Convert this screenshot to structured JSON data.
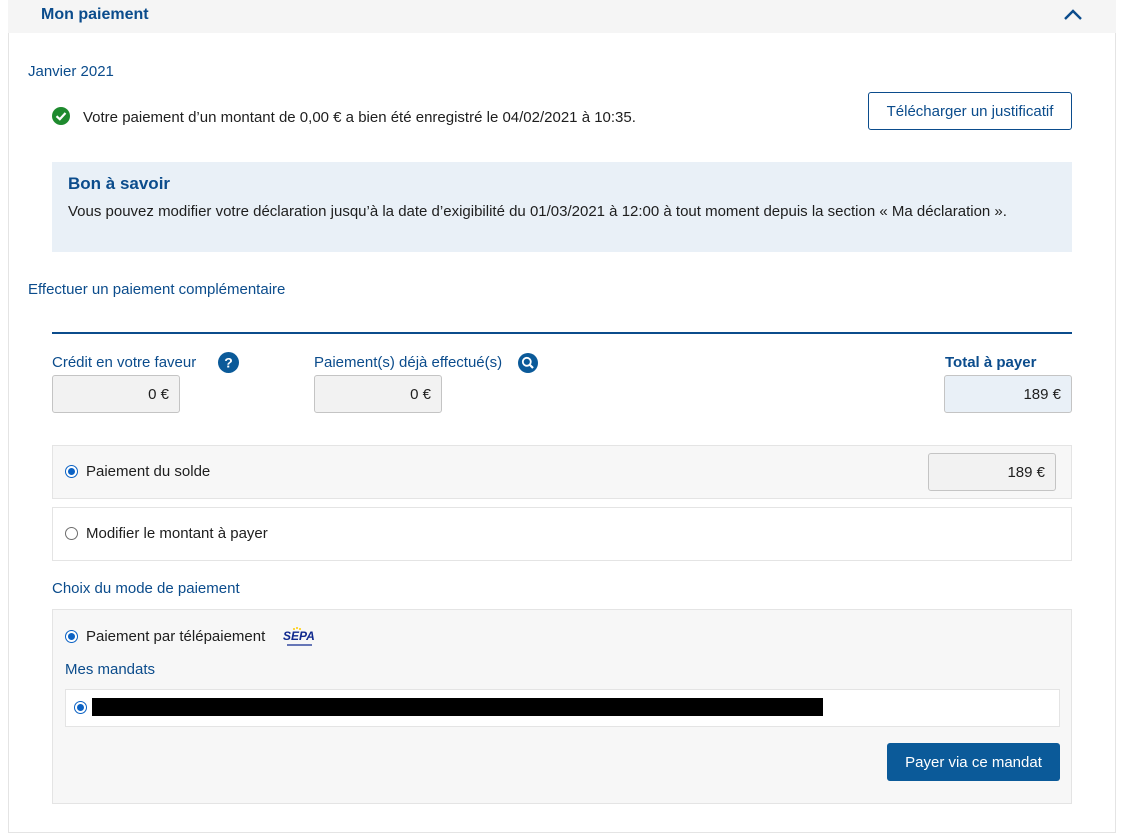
{
  "header": {
    "title": "Mon paiement",
    "toggle_icon": "chevron-up-icon"
  },
  "payment": {
    "month": "Janvier 2021",
    "status_icon": "check-circle-icon",
    "confirmation": "Votre paiement d’un montant de 0,00 € a bien été enregistré le 04/02/2021 à 10:35.",
    "download_button": "Télécharger un justificatif"
  },
  "info": {
    "title": "Bon à savoir",
    "text": "Vous pouvez modifier votre déclaration jusqu’à la date d’exigibilité du 01/03/2021 à 12:00 à tout moment depuis la section « Ma déclaration »."
  },
  "complement": {
    "link": "Effectuer un paiement complémentaire",
    "credit_label": "Crédit en votre faveur",
    "credit_value": "0 €",
    "paid_label": "Paiement(s) déjà effectué(s)",
    "paid_value": "0 €",
    "total_label": "Total à payer",
    "total_value": "189 €"
  },
  "options": {
    "solde_label": "Paiement du solde",
    "solde_value": "189 €",
    "solde_selected": true,
    "modify_label": "Modifier le montant à payer",
    "modify_selected": false
  },
  "mode": {
    "title": "Choix du mode de paiement",
    "tele_label": "Paiement par télépaiement",
    "logo_text": "SEPA",
    "mandats_title": "Mes mandats",
    "pay_button": "Payer via ce mandat"
  },
  "colors": {
    "brand_blue": "#0b4c8c",
    "button_blue": "#0b5a99",
    "success_green": "#1e8a2e",
    "info_bg": "#e9f0f7"
  }
}
